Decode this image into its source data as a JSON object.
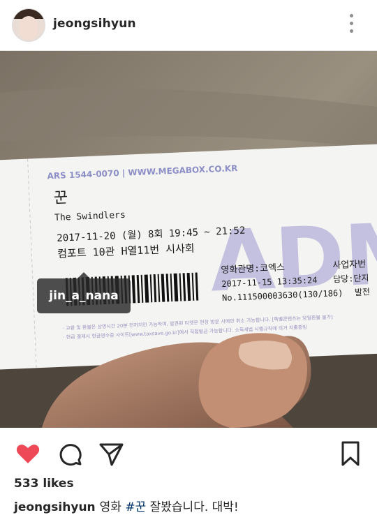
{
  "post": {
    "username": "jeongsihyun",
    "likes": "533 likes",
    "caption": {
      "username": "jeongsihyun",
      "text_before": "영화 ",
      "hashtag": "#꾼",
      "text_after": " 잘봤습니다. 대박!"
    }
  },
  "photo": {
    "tag_label": "jin_a_nana",
    "ticket": {
      "header": "ARS 1544-0070   |   WWW.MEGABOX.CO.KR",
      "title_kr": "꾼",
      "title_en": "The Swindlers",
      "datetime": "2017-11-20 (월) 8회 19:45 ~ 21:52",
      "seat": "컴포트 10관 H열11번 시사회",
      "watermark": "ADMIT O",
      "cinema": "영화관명:코엑스",
      "issued": "2017-11-15 13:35:24",
      "number": "No.111500003630(130/186)",
      "business": "사업자번",
      "manager": "담당:단지",
      "issuer": "발전",
      "notice1": "· 교환 및 환불은 상영시간 20분 전까지만 가능하며, 발권된 티켓은 현장 방문 시에만 취소 가능합니다. [특별콘텐츠는 당일환불 불가]",
      "notice2": "· 현금 결제시 현금영수증 사이트[www.taxsave.go.kr]에서 직접발급 가능합니다. 소득세법 시행규칙에 의거 지출증빙"
    }
  },
  "icons": {
    "heart_color": "#ed4956",
    "more": "more-options-icon",
    "like": "heart-icon",
    "comment": "comment-icon",
    "share": "send-icon",
    "save": "bookmark-icon",
    "tagged": "tagged-people-icon"
  }
}
